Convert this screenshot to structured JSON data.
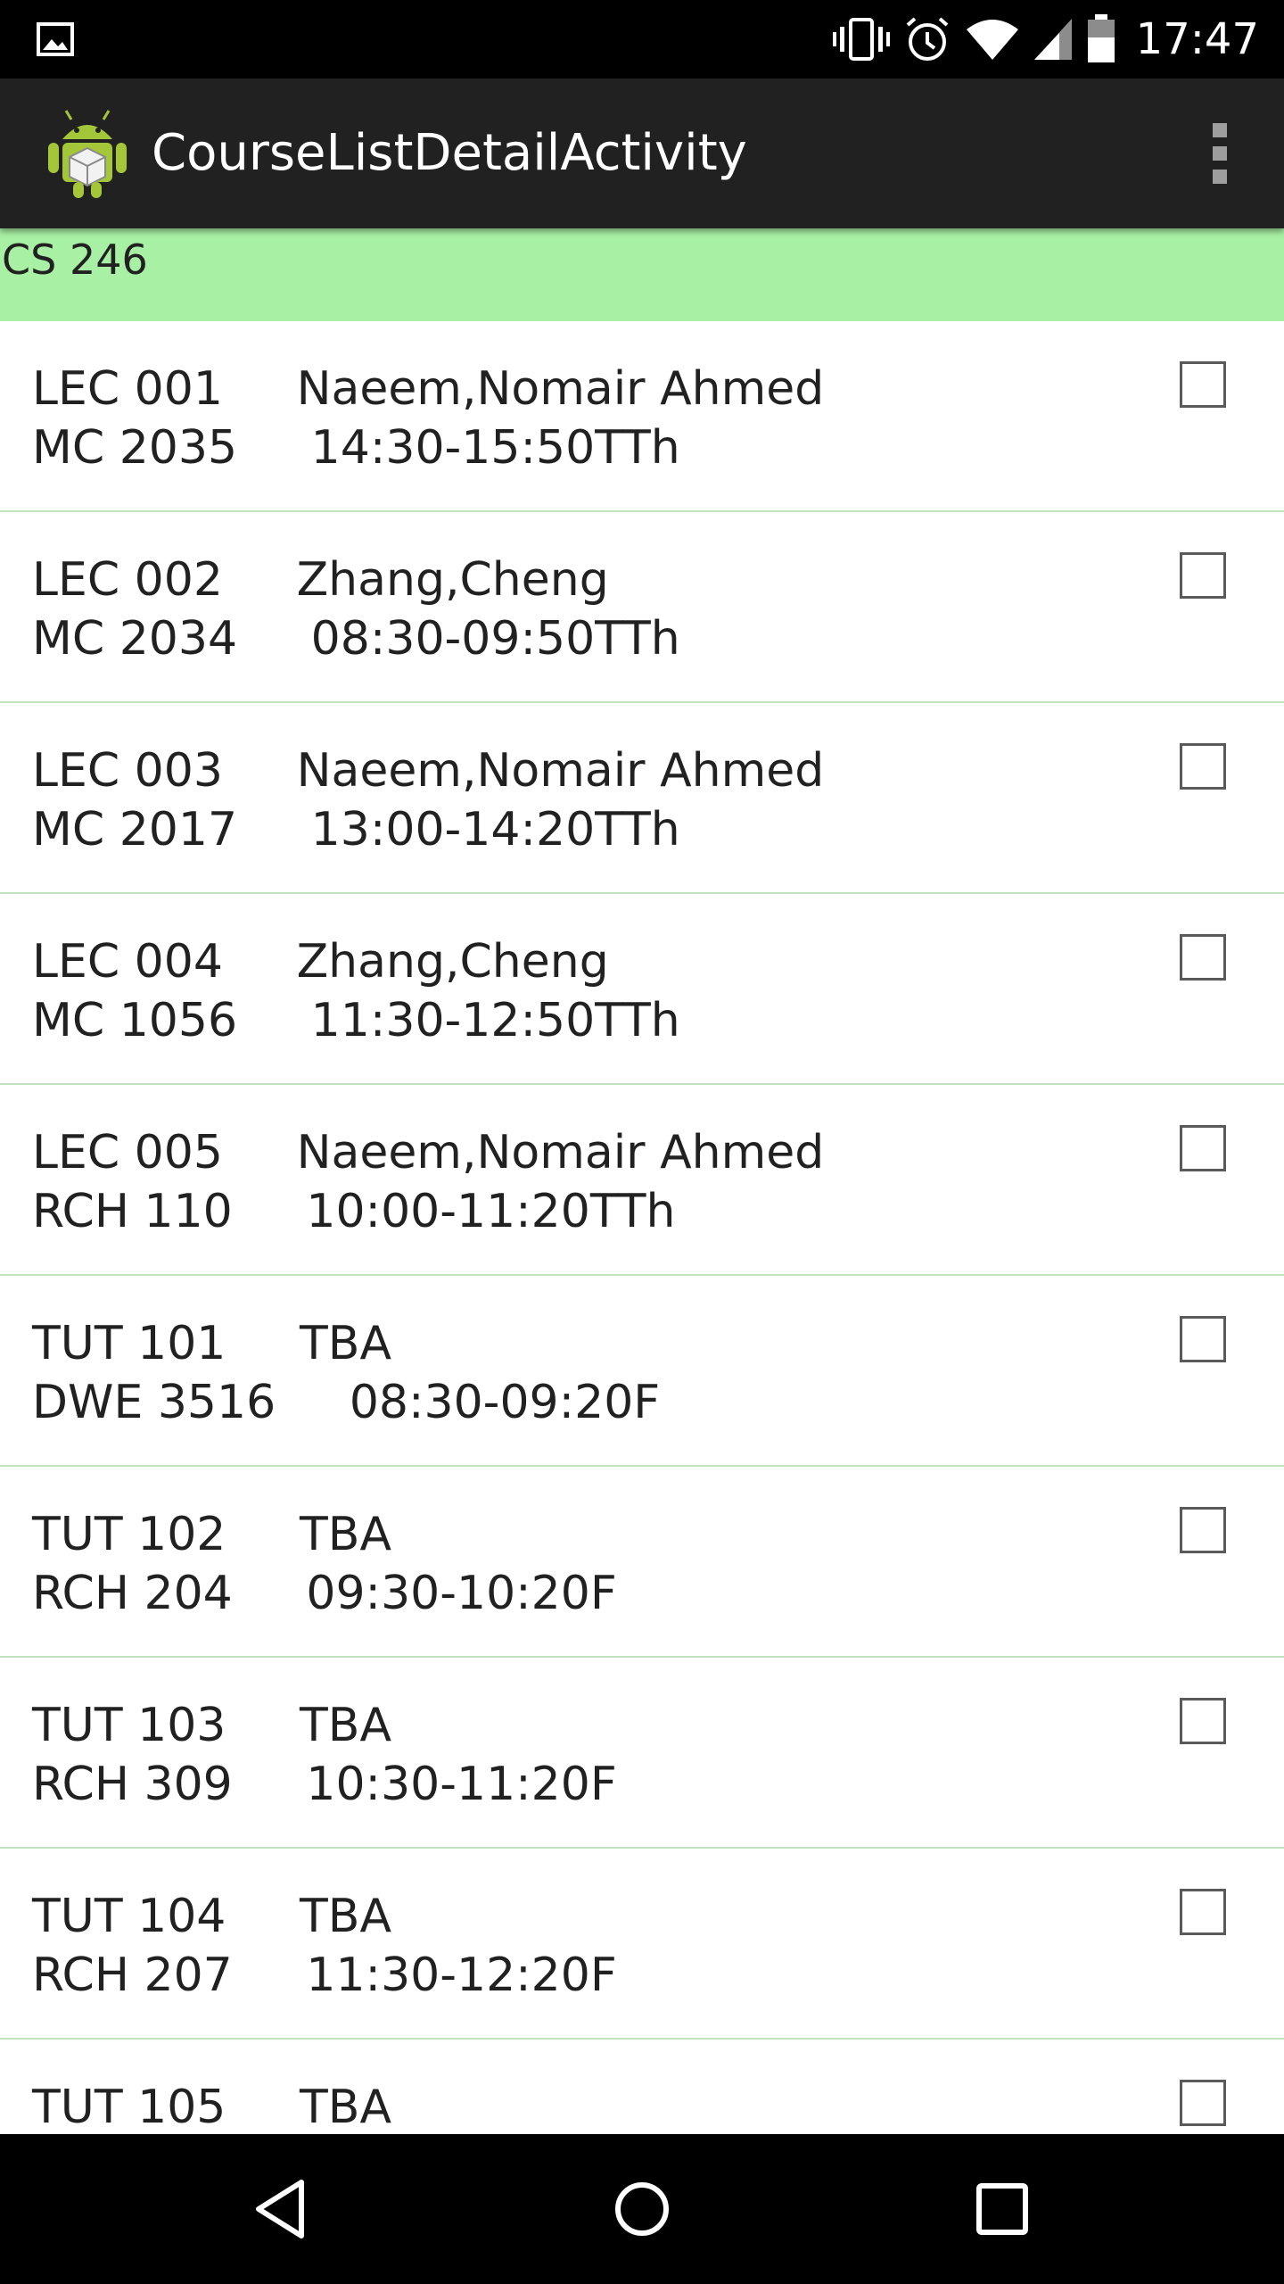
{
  "status_bar": {
    "time": "17:47",
    "icons": [
      "image-notification-icon",
      "vibrate-icon",
      "alarm-icon",
      "wifi-icon",
      "signal-icon",
      "battery-icon"
    ]
  },
  "action_bar": {
    "title": "CourseListDetailActivity",
    "app_icon": "android-robot-icon",
    "menu_icon": "overflow-menu-icon"
  },
  "course": {
    "code": "CS 246"
  },
  "colors": {
    "header_bg": "#a8f0a4",
    "action_bar_bg": "#212121",
    "divider": "#bfe3bd"
  },
  "sections": [
    {
      "line1": "LEC 001     Naeem,Nomair Ahmed",
      "line2": "MC 2035     14:30-15:50TTh",
      "checked": false
    },
    {
      "line1": "LEC 002     Zhang,Cheng",
      "line2": "MC 2034     08:30-09:50TTh",
      "checked": false
    },
    {
      "line1": "LEC 003     Naeem,Nomair Ahmed",
      "line2": "MC 2017     13:00-14:20TTh",
      "checked": false
    },
    {
      "line1": "LEC 004     Zhang,Cheng",
      "line2": "MC 1056     11:30-12:50TTh",
      "checked": false
    },
    {
      "line1": "LEC 005     Naeem,Nomair Ahmed",
      "line2": "RCH 110     10:00-11:20TTh",
      "checked": false
    },
    {
      "line1": "TUT 101     TBA",
      "line2": "DWE 3516     08:30-09:20F",
      "checked": false
    },
    {
      "line1": "TUT 102     TBA",
      "line2": "RCH 204     09:30-10:20F",
      "checked": false
    },
    {
      "line1": "TUT 103     TBA",
      "line2": "RCH 309     10:30-11:20F",
      "checked": false
    },
    {
      "line1": "TUT 104     TBA",
      "line2": "RCH 207     11:30-12:20F",
      "checked": false
    },
    {
      "line1": "TUT 105     TBA",
      "line2": "",
      "checked": false
    }
  ],
  "nav_bar": {
    "buttons": [
      "back-icon",
      "home-icon",
      "recents-icon"
    ]
  }
}
